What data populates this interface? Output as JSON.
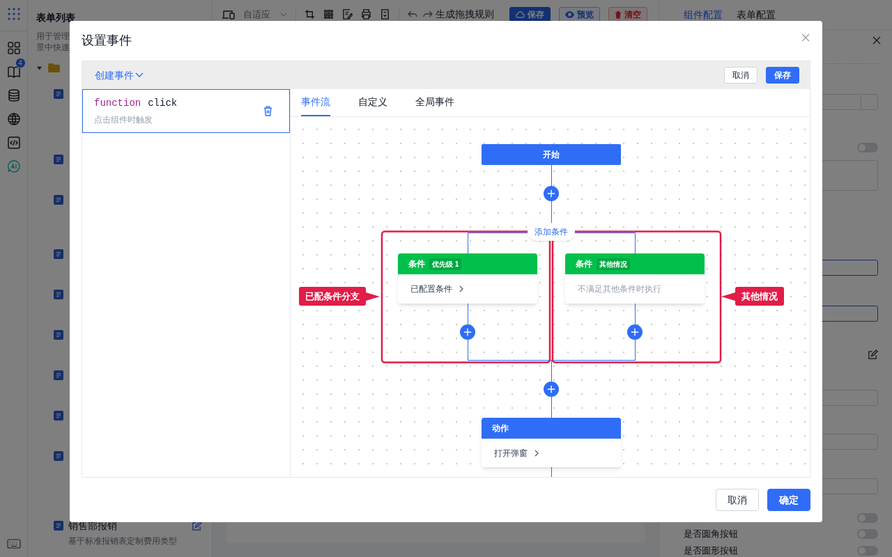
{
  "background": {
    "rail": {
      "badge": "4"
    },
    "list_panel": {
      "title": "表单列表",
      "description_lines": [
        "用于管理",
        "景中快速"
      ],
      "folder": {
        "expanded": true
      },
      "item": {
        "title": "销售部报销",
        "description": "基于标准报销表定制费用类型"
      }
    },
    "toolbar": {
      "device_select": "自适应",
      "rule_button": "生成拖拽规则",
      "buttons": [
        {
          "label": "保存",
          "kind": "primary"
        },
        {
          "label": "预览",
          "kind": "info"
        },
        {
          "label": "清空",
          "kind": "danger"
        }
      ]
    },
    "config_panel": {
      "tabs": [
        {
          "label": "组件配置",
          "selected": true
        },
        {
          "label": "表单配置",
          "selected": false
        }
      ],
      "toggles": [
        {
          "on": false
        },
        {
          "on": false
        }
      ],
      "settings": [
        {
          "label": "是否圆角按钮",
          "on": false
        },
        {
          "label": "是否圆形按钮",
          "on": false
        }
      ]
    }
  },
  "dialog": {
    "title": "设置事件",
    "create_event_button": "创建事件",
    "header_buttons": [
      {
        "label": "取消",
        "kind": "default"
      },
      {
        "label": "保存",
        "kind": "primary"
      }
    ],
    "events": [
      {
        "keyword": "function",
        "name": "click",
        "description": "点击组件时触发",
        "selected": true
      }
    ],
    "tabs": [
      {
        "label": "事件流",
        "selected": true
      },
      {
        "label": "自定义",
        "selected": false
      },
      {
        "label": "全局事件",
        "selected": false
      }
    ],
    "flow": {
      "start": "开始",
      "add_condition": "添加条件",
      "branches": [
        {
          "title": "条件",
          "badge": "优先级 1",
          "body": "已配置条件",
          "configured": true
        },
        {
          "title": "条件",
          "badge": "其他情况",
          "body": "不满足其他条件时执行",
          "configured": false
        }
      ],
      "action": {
        "title": "动作",
        "body": "打开弹窗"
      }
    },
    "annotations": [
      {
        "label": "已配条件分支"
      },
      {
        "label": "其他情况"
      }
    ],
    "footer_buttons": [
      {
        "label": "取消",
        "kind": "default"
      },
      {
        "label": "确定",
        "kind": "primary"
      }
    ]
  }
}
